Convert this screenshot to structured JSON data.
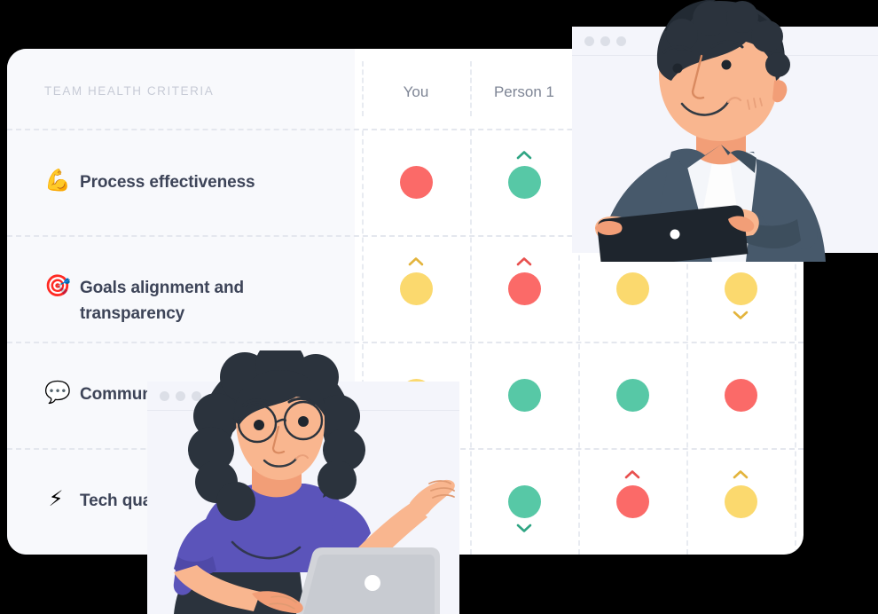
{
  "card": {
    "criteria_header": "TEAM HEALTH CRITERIA",
    "columns": [
      {
        "label": "You"
      },
      {
        "label": "Person 1"
      }
    ],
    "rows": [
      {
        "emoji": "💪",
        "label": "Process effectiveness",
        "cells": [
          {
            "color": "red",
            "trend": "none"
          },
          {
            "color": "green",
            "trend": "up"
          }
        ]
      },
      {
        "emoji": "🎯",
        "label": "Goals alignment and transparency",
        "cells": [
          {
            "color": "yellow",
            "trend": "up"
          },
          {
            "color": "red",
            "trend": "up"
          },
          {
            "color": "yellow",
            "trend": "none"
          },
          {
            "color": "yellow",
            "trend": "down"
          }
        ]
      },
      {
        "emoji": "💬",
        "label": "Communication",
        "cells": [
          {
            "color": "green",
            "trend": "none"
          },
          {
            "color": "green",
            "trend": "none"
          },
          {
            "color": "green",
            "trend": "none"
          },
          {
            "color": "red",
            "trend": "none"
          }
        ]
      },
      {
        "emoji": "⚡",
        "label": "Tech quality",
        "cells": [
          {
            "color": "yellow",
            "trend": "none"
          },
          {
            "color": "green",
            "trend": "down"
          },
          {
            "color": "red",
            "trend": "up"
          },
          {
            "color": "yellow",
            "trend": "up"
          }
        ]
      }
    ]
  },
  "windows": [
    {
      "name": "video-tile-man",
      "dots": 3
    },
    {
      "name": "video-tile-woman",
      "dots": 3
    }
  ],
  "colors": {
    "red": "#fb6a68",
    "green": "#57c8a6",
    "yellow": "#fbd96e",
    "card_bg": "#ffffff",
    "panel_bg": "#f8f9fc",
    "header_text": "#c7cbd6",
    "column_text": "#7e8595",
    "row_text": "#3d4458",
    "window_bg": "#f4f5fb",
    "window_dot": "#dcdfe7",
    "man_shirt": "#47596b",
    "woman_shirt": "#5b54ba",
    "skin": "#f9b68f",
    "hair": "#2b333d"
  }
}
